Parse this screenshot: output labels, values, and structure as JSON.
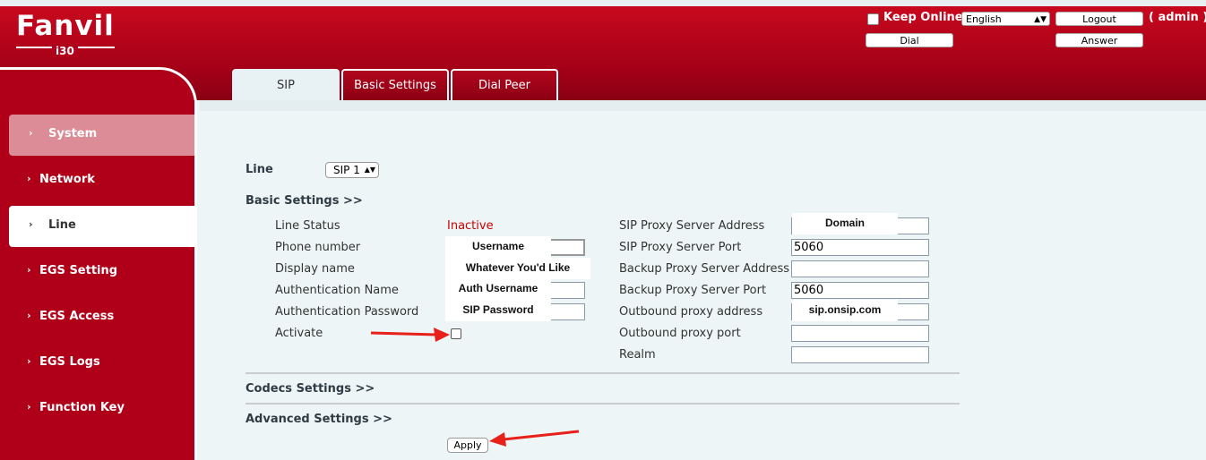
{
  "header": {
    "logo_text": "Fanvil",
    "model": "i30",
    "keep_online_label": "Keep Online",
    "language": "English",
    "logout_label": "Logout",
    "user_label": "( admin )",
    "dial_label": "Dial",
    "answer_label": "Answer"
  },
  "tabs": [
    {
      "label": "SIP"
    },
    {
      "label": "Basic Settings"
    },
    {
      "label": "Dial Peer"
    }
  ],
  "sidebar": {
    "items": [
      {
        "label": "System"
      },
      {
        "label": "Network"
      },
      {
        "label": "Line"
      },
      {
        "label": "EGS Setting"
      },
      {
        "label": "EGS Access"
      },
      {
        "label": "EGS Logs"
      },
      {
        "label": "Function Key"
      }
    ]
  },
  "form": {
    "line_label": "Line",
    "line_value": "SIP 1",
    "basic_settings": "Basic Settings >>",
    "left": {
      "line_status_label": "Line Status",
      "line_status_value": "Inactive",
      "phone_number_label": "Phone number",
      "phone_number_overlay": "Username",
      "display_name_label": "Display name",
      "display_name_overlay": "Whatever You'd Like",
      "auth_name_label": "Authentication Name",
      "auth_name_overlay": "Auth Username",
      "auth_password_label": "Authentication Password",
      "auth_password_overlay": "SIP Password",
      "activate_label": "Activate"
    },
    "right": {
      "proxy_address_label": "SIP Proxy Server Address",
      "proxy_address_overlay": "Domain",
      "proxy_port_label": "SIP Proxy Server Port",
      "proxy_port_value": "5060",
      "backup_address_label": "Backup Proxy Server Address",
      "backup_address_value": "",
      "backup_port_label": "Backup Proxy Server Port",
      "backup_port_value": "5060",
      "outbound_address_label": "Outbound proxy address",
      "outbound_address_overlay": "sip.onsip.com",
      "outbound_port_label": "Outbound proxy port",
      "outbound_port_value": "",
      "realm_label": "Realm",
      "realm_value": ""
    },
    "codecs_settings": "Codecs Settings >>",
    "advanced_settings": "Advanced Settings >>",
    "apply_label": "Apply"
  },
  "colors": {
    "brand_red": "#b00019",
    "annotation_arrow": "#e8201a",
    "inactive_text": "#cc0000"
  }
}
